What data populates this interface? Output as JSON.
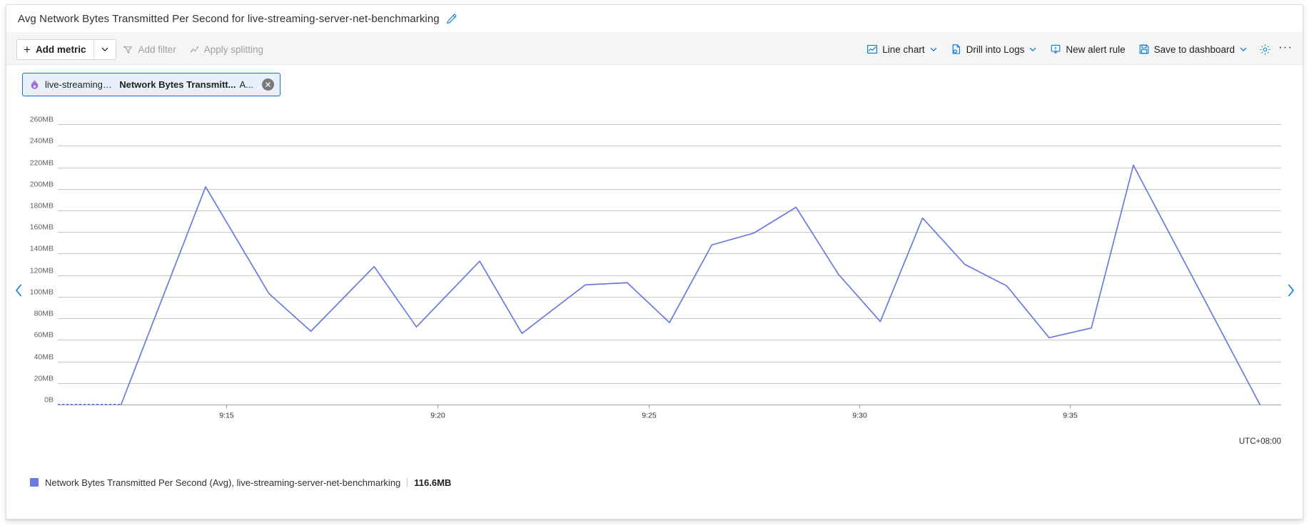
{
  "header": {
    "title": "Avg Network Bytes Transmitted Per Second for live-streaming-server-net-benchmarking",
    "edit_icon": "pencil-icon"
  },
  "toolbar": {
    "add_metric_label": "Add metric",
    "add_metric_caret": "chevron-down-icon",
    "add_filter_label": "Add filter",
    "apply_splitting_label": "Apply splitting",
    "line_chart_label": "Line chart",
    "drill_into_logs_label": "Drill into Logs",
    "new_alert_rule_label": "New alert rule",
    "save_to_dashboard_label": "Save to dashboard",
    "settings_icon": "gear-icon",
    "more_label": "···"
  },
  "metric_chip": {
    "resource_icon": "resource-icon",
    "resource": "live-streaming-server-net-...",
    "metric": "Network Bytes Transmitt...",
    "aggregation": "A...",
    "close_icon": "close-icon"
  },
  "chart": {
    "nav_prev_icon": "chevron-left-icon",
    "nav_next_icon": "chevron-right-icon",
    "timezone": "UTC+08:00"
  },
  "legend": {
    "swatch_color": "#6a79e0",
    "text": "Network Bytes Transmitted Per Second (Avg), live-streaming-server-net-benchmarking",
    "value": "116.6MB"
  },
  "colors": {
    "series": "#6a79e0",
    "accent": "#0078d4",
    "grid": "#c8c6c4",
    "chip_border": "#1a6dc0",
    "chip_bg": "#e8f1fb"
  },
  "chart_data": {
    "type": "line",
    "title": "Avg Network Bytes Transmitted Per Second for live-streaming-server-net-benchmarking",
    "xlabel": "",
    "ylabel": "",
    "unit": "MB",
    "timezone": "UTC+08:00",
    "grid": true,
    "legend_position": "bottom-left",
    "ylim": [
      0,
      270
    ],
    "ytick_labels": [
      "260MB",
      "240MB",
      "220MB",
      "200MB",
      "180MB",
      "160MB",
      "140MB",
      "120MB",
      "100MB",
      "80MB",
      "60MB",
      "40MB",
      "20MB",
      "0B"
    ],
    "ytick_values": [
      260,
      240,
      220,
      200,
      180,
      160,
      140,
      120,
      100,
      80,
      60,
      40,
      20,
      0
    ],
    "xtick_labels": [
      "9:15",
      "9:20",
      "9:25",
      "9:30",
      "9:35"
    ],
    "xtick_times": [
      9.25,
      9.3333,
      9.4167,
      9.5,
      9.5833
    ],
    "xlim": [
      9.1833,
      9.6667
    ],
    "series": [
      {
        "name": "Network Bytes Transmitted Per Second (Avg), live-streaming-server-net-benchmarking",
        "color": "#6a79e0",
        "current_value": "116.6MB",
        "x": [
          9.1833,
          9.1917,
          9.2,
          9.2083,
          9.2417,
          9.2667,
          9.2833,
          9.3083,
          9.325,
          9.35,
          9.3667,
          9.3917,
          9.4083,
          9.425,
          9.4417,
          9.4583,
          9.475,
          9.4917,
          9.5083,
          9.525,
          9.5417,
          9.5583,
          9.575,
          9.5917,
          9.6083,
          9.6583
        ],
        "y": [
          0,
          0,
          0,
          0,
          202,
          103,
          68,
          128,
          72,
          133,
          66,
          111,
          113,
          76,
          148,
          159,
          183,
          121,
          77,
          173,
          130,
          110,
          62,
          71,
          222,
          0
        ]
      }
    ]
  }
}
